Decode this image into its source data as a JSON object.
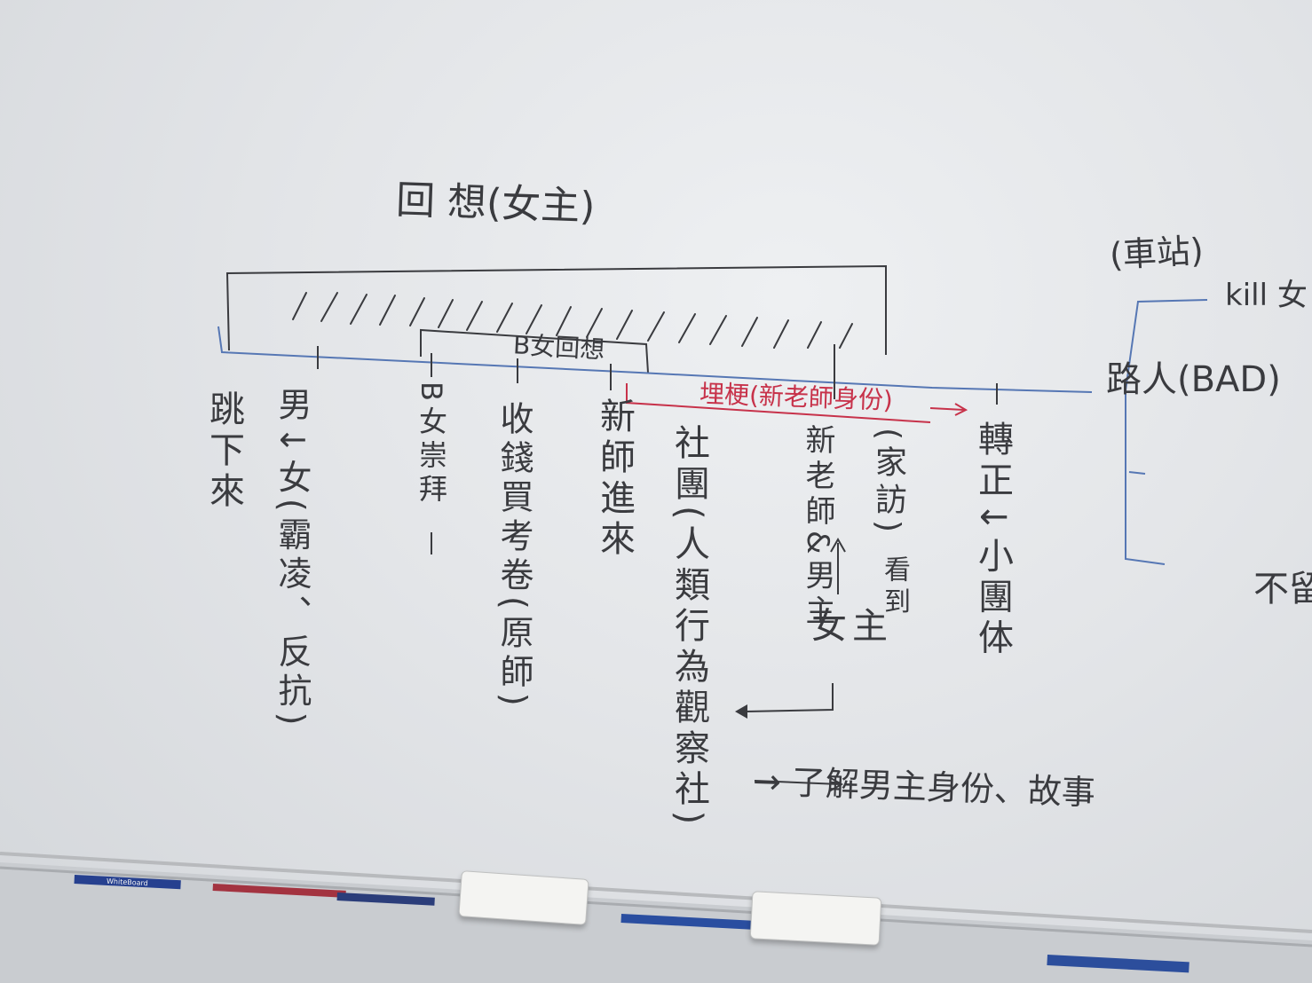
{
  "board": {
    "title": "回 想(女主)",
    "station_label": "(車站)",
    "kill_label": "kill 女",
    "passerby_label": "路人(BAD)",
    "not_label": "不留",
    "bracket_label": "B女回想",
    "red_label": "埋梗(新老師身份)",
    "bottom_note": "→ 了解男主身份、故事",
    "columns": [
      {
        "text": "跳下來"
      },
      {
        "text": "男↓女(霸凌、反抗)"
      },
      {
        "text": "B女崇拜"
      },
      {
        "text": "收錢買考卷(原師)"
      },
      {
        "text": "新師進來"
      },
      {
        "text": "社團(人類行為觀察社)"
      },
      {
        "text": "新老師&男主"
      },
      {
        "text": "(家訪)"
      },
      {
        "text": "看到"
      },
      {
        "text": "女主"
      },
      {
        "text": "轉正↓小團体"
      }
    ]
  },
  "tray": {
    "marker_brand": "WhiteBoard"
  },
  "colors": {
    "ink": "#3a3b3f",
    "blue_line": "#5677b4",
    "red_ink": "#c7324a"
  }
}
